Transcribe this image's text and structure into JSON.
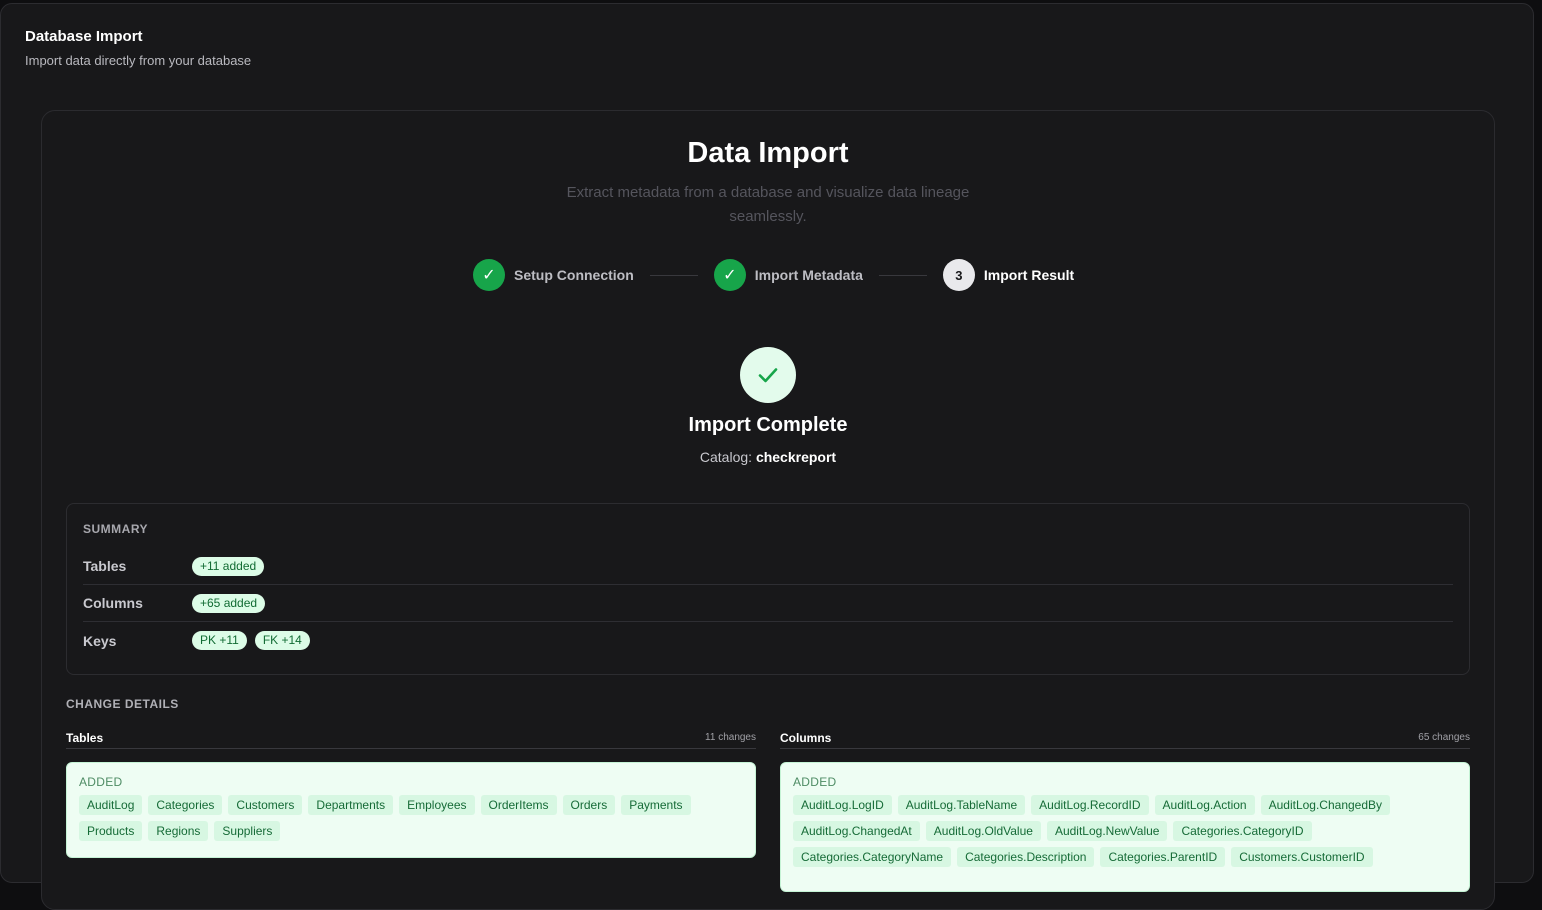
{
  "header": {
    "title": "Database Import",
    "subtitle": "Import data directly from your database"
  },
  "hero": {
    "title": "Data Import",
    "description": "Extract metadata from a database and visualize data lineage seamlessly."
  },
  "steps": [
    {
      "label": "Setup Connection",
      "status": "done",
      "marker": "✓"
    },
    {
      "label": "Import Metadata",
      "status": "done",
      "marker": "✓"
    },
    {
      "label": "Import Result",
      "status": "current",
      "marker": "3"
    }
  ],
  "result": {
    "title": "Import Complete",
    "catalog_label": "Catalog:",
    "catalog_name": "checkreport"
  },
  "summary": {
    "heading": "SUMMARY",
    "rows": [
      {
        "label": "Tables",
        "pills": [
          "+11 added"
        ]
      },
      {
        "label": "Columns",
        "pills": [
          "+65 added"
        ]
      },
      {
        "label": "Keys",
        "pills": [
          "PK +11",
          "FK +14"
        ]
      }
    ]
  },
  "change_details": {
    "heading": "CHANGE DETAILS",
    "tables": {
      "title": "Tables",
      "count": "11 changes",
      "added_label": "ADDED",
      "items": [
        "AuditLog",
        "Categories",
        "Customers",
        "Departments",
        "Employees",
        "OrderItems",
        "Orders",
        "Payments",
        "Products",
        "Regions",
        "Suppliers"
      ]
    },
    "columns": {
      "title": "Columns",
      "count": "65 changes",
      "added_label": "ADDED",
      "items": [
        "AuditLog.LogID",
        "AuditLog.TableName",
        "AuditLog.RecordID",
        "AuditLog.Action",
        "AuditLog.ChangedBy",
        "AuditLog.ChangedAt",
        "AuditLog.OldValue",
        "AuditLog.NewValue",
        "Categories.CategoryID",
        "Categories.CategoryName",
        "Categories.Description",
        "Categories.ParentID",
        "Customers.CustomerID"
      ]
    }
  },
  "colors": {
    "accent_green": "#17a54a",
    "pill_bg": "#dcfce7",
    "pill_text": "#116b33"
  }
}
